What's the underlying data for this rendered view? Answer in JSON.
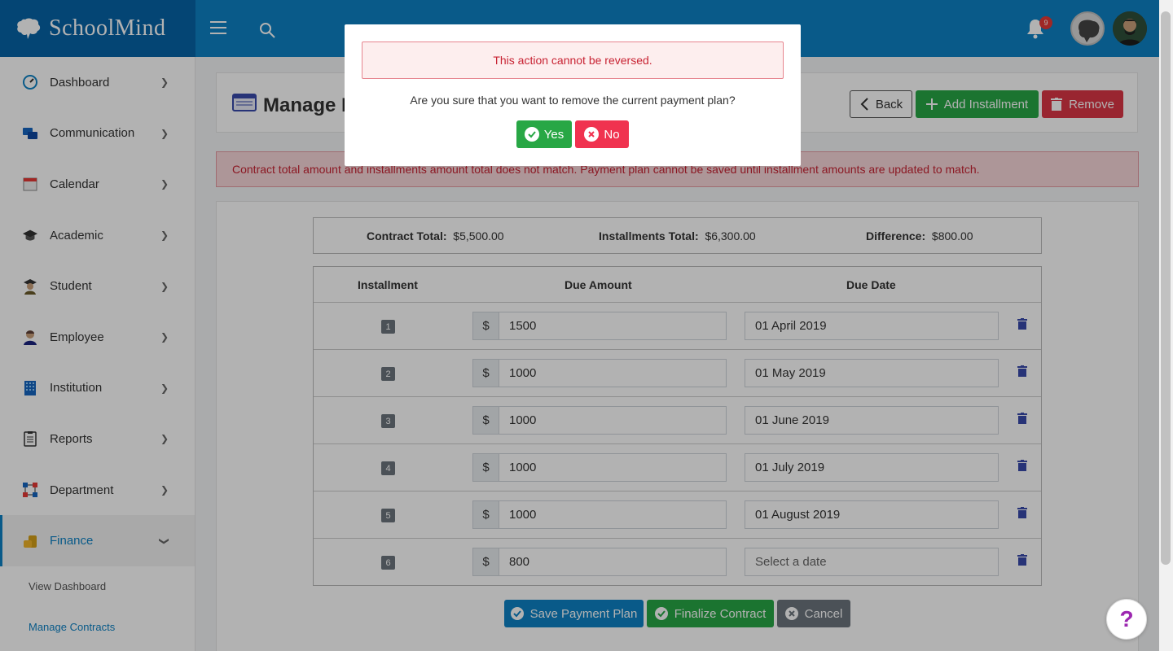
{
  "header": {
    "logo_text": "SchoolMind",
    "notification_count": "9"
  },
  "sidebar": {
    "items": [
      {
        "label": "Dashboard",
        "icon": "dashboard-gauge-icon"
      },
      {
        "label": "Communication",
        "icon": "chat-bubbles-icon"
      },
      {
        "label": "Calendar",
        "icon": "calendar-icon"
      },
      {
        "label": "Academic",
        "icon": "graduation-cap-icon"
      },
      {
        "label": "Student",
        "icon": "student-icon"
      },
      {
        "label": "Employee",
        "icon": "employee-icon"
      },
      {
        "label": "Institution",
        "icon": "building-icon"
      },
      {
        "label": "Reports",
        "icon": "clipboard-icon"
      },
      {
        "label": "Department",
        "icon": "org-chart-icon"
      },
      {
        "label": "Finance",
        "icon": "coins-icon"
      }
    ],
    "sub_items": [
      {
        "label": "View Dashboard"
      },
      {
        "label": "Manage Contracts"
      }
    ]
  },
  "page": {
    "title": "Manage F",
    "back_label": "Back",
    "add_label": "Add Installment",
    "remove_label": "Remove"
  },
  "alert": {
    "text": "Contract total amount and installments amount total does not match. Payment plan cannot be saved until installment amounts are updated to match."
  },
  "summary": {
    "contract_label": "Contract Total:",
    "contract_value": "$5,500.00",
    "installments_label": "Installments Total:",
    "installments_value": "$6,300.00",
    "difference_label": "Difference:",
    "difference_value": "$800.00"
  },
  "table": {
    "headers": [
      "Installment",
      "Due Amount",
      "Due Date"
    ],
    "currency": "$",
    "rows": [
      {
        "num": "1",
        "amount": "1500",
        "date": "01 April 2019"
      },
      {
        "num": "2",
        "amount": "1000",
        "date": "01 May 2019"
      },
      {
        "num": "3",
        "amount": "1000",
        "date": "01 June 2019"
      },
      {
        "num": "4",
        "amount": "1000",
        "date": "01 July 2019"
      },
      {
        "num": "5",
        "amount": "1000",
        "date": "01 August 2019"
      },
      {
        "num": "6",
        "amount": "800",
        "date": "",
        "date_placeholder": "Select a date"
      }
    ]
  },
  "footer_buttons": {
    "save_label": "Save Payment Plan",
    "finalize_label": "Finalize Contract",
    "cancel_label": "Cancel"
  },
  "help": {
    "label": "?"
  },
  "modal": {
    "alert": "This action cannot be reversed.",
    "question": "Are you sure that you want to remove the current payment plan?",
    "yes_label": "Yes",
    "no_label": "No"
  },
  "colors": {
    "header": "#0d82c4",
    "logo_bg": "#0663a7",
    "success": "#28a745",
    "danger": "#dc3545"
  }
}
